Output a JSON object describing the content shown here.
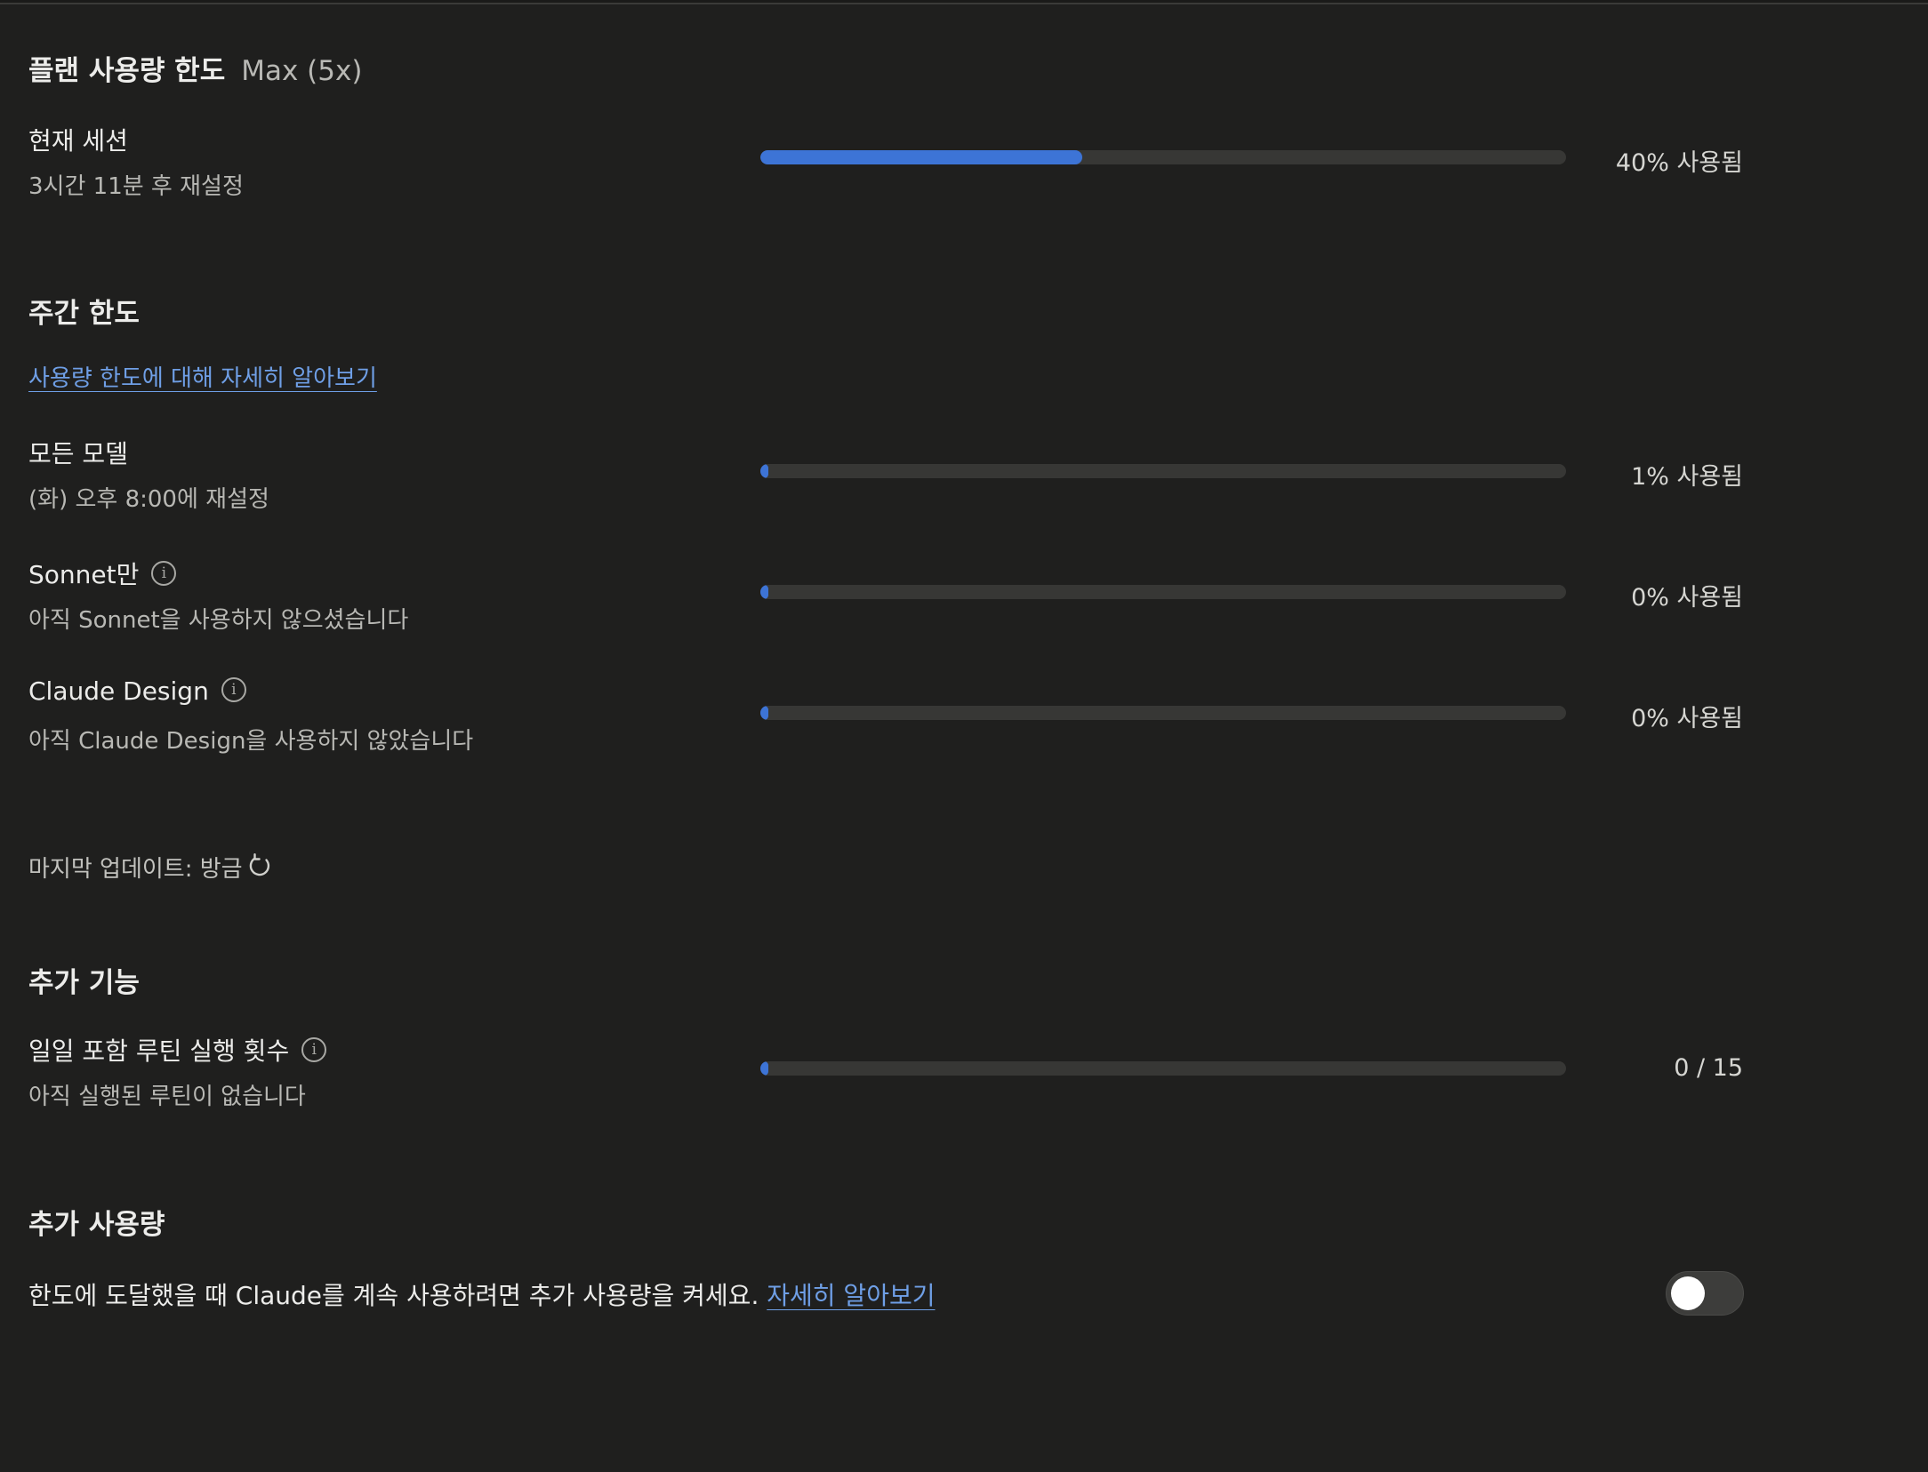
{
  "plan": {
    "title": "플랜 사용량 한도",
    "tier": "Max (5x)"
  },
  "current_session": {
    "title": "현재 세션",
    "subtitle": "3시간 11분 후 재설정",
    "usage_label": "40% 사용됨",
    "progress": 0.4
  },
  "weekly": {
    "title": "주간 한도",
    "learn_more_link": "사용량 한도에 대해 자세히 알아보기",
    "rows": [
      {
        "title": "모든 모델",
        "subtitle": "(화) 오후 8:00에 재설정",
        "usage_label": "1% 사용됨",
        "progress": 0.01,
        "has_info": false
      },
      {
        "title": "Sonnet만",
        "subtitle": "아직 Sonnet을 사용하지 않으셨습니다",
        "usage_label": "0% 사용됨",
        "progress": 0.0,
        "has_info": true
      },
      {
        "title": "Claude Design",
        "subtitle": "아직 Claude Design을 사용하지 않았습니다",
        "usage_label": "0% 사용됨",
        "progress": 0.0,
        "has_info": true
      }
    ]
  },
  "last_update": {
    "label": "마지막 업데이트: 방금"
  },
  "extra_features": {
    "title": "추가 기능",
    "routine": {
      "title": "일일 포함 루틴 실행 횟수",
      "subtitle": "아직 실행된 루틴이 없습니다",
      "count_label": "0 / 15",
      "progress": 0.0
    }
  },
  "extra_usage": {
    "title": "추가 사용량",
    "description": "한도에 도달했을 때 Claude를 계속 사용하려면 추가 사용량을 켜세요.",
    "learn_more_link": "자세히 알아보기",
    "toggle_on": false
  },
  "icons": {
    "info": "info-icon",
    "refresh": "refresh-icon"
  },
  "colors": {
    "background": "#1f1f1e",
    "accent": "#3d74d6",
    "link": "#6f9fe6",
    "track": "#373735"
  }
}
